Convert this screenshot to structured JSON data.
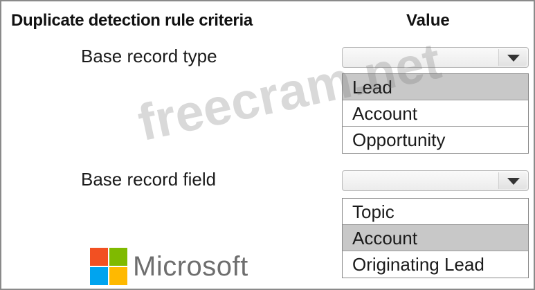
{
  "header": {
    "criteria": "Duplicate detection rule criteria",
    "value": "Value"
  },
  "rows": [
    {
      "label": "Base record type",
      "options": [
        "Lead",
        "Account",
        "Opportunity"
      ],
      "selected_index": 0
    },
    {
      "label": "Base record field",
      "options": [
        "Topic",
        "Account",
        "Originating Lead"
      ],
      "selected_index": 1
    }
  ],
  "brand": {
    "name": "Microsoft",
    "logo_colors": [
      "#f25022",
      "#7fba00",
      "#00a4ef",
      "#ffb900"
    ]
  },
  "watermark": "freecram.net",
  "colors": {
    "selected_option": "#c8c8c8",
    "border": "#8a8a8a"
  }
}
